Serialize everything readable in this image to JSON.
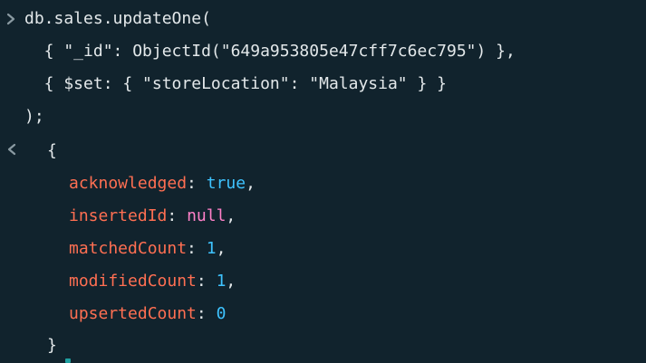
{
  "input": {
    "prompt_icon": "chevron-right-icon",
    "lines": [
      "db.sales.updateOne(",
      "  { \"_id\": ObjectId(\"649a953805e47cff7c6ec795\") },",
      "  { $set: { \"storeLocation\": \"Malaysia\" } }",
      ");"
    ]
  },
  "output": {
    "prompt_icon": "chevron-left-icon",
    "open_brace": "{",
    "close_brace": "}",
    "fields": [
      {
        "key": "acknowledged",
        "value": "true",
        "type": "bool"
      },
      {
        "key": "insertedId",
        "value": "null",
        "type": "null"
      },
      {
        "key": "matchedCount",
        "value": "1",
        "type": "num"
      },
      {
        "key": "modifiedCount",
        "value": "1",
        "type": "num"
      },
      {
        "key": "upsertedCount",
        "value": "0",
        "type": "num"
      }
    ],
    "colon": ": ",
    "comma": ","
  },
  "colors": {
    "background": "#11232d",
    "text": "#e3e8ea",
    "key": "#ff6f52",
    "boolean": "#3ec3ff",
    "null": "#ff80c8",
    "number": "#3ec3ff"
  }
}
